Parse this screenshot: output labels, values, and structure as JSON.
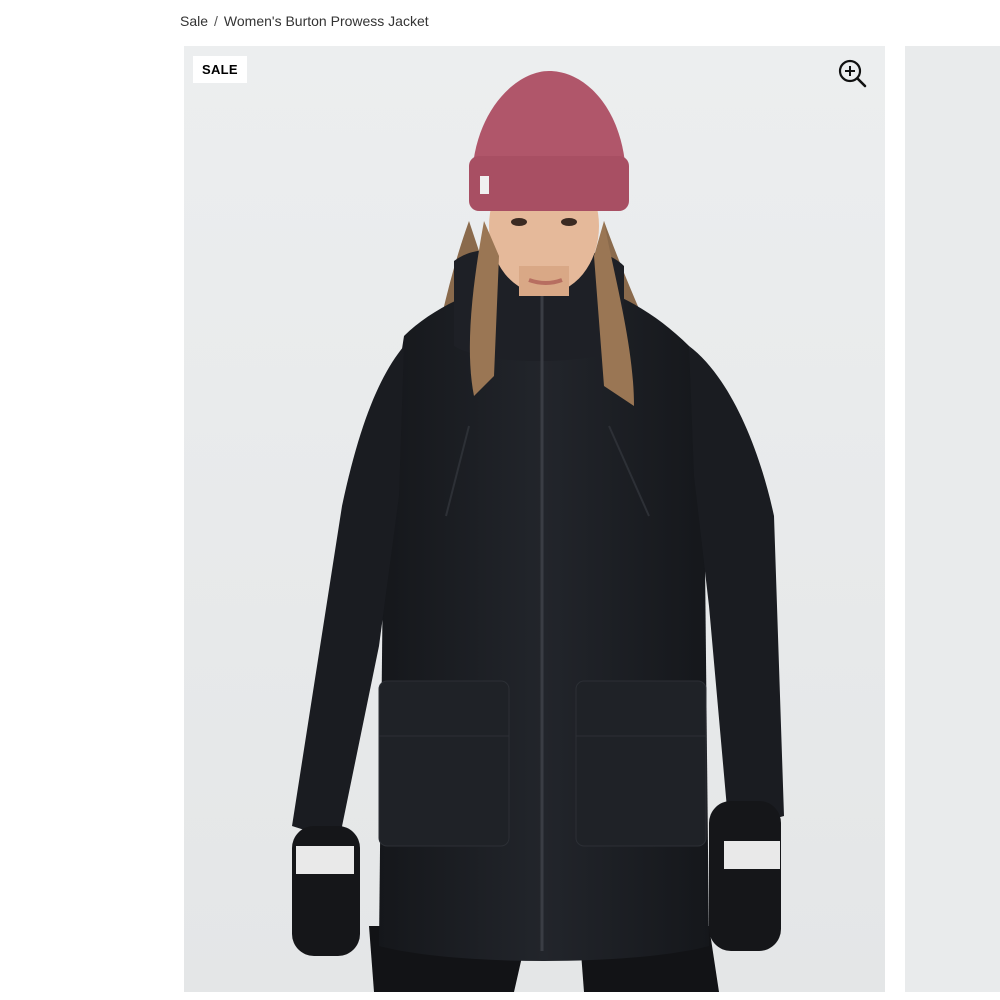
{
  "breadcrumb": {
    "items": [
      "Sale",
      "Women's Burton Prowess Jacket"
    ],
    "separator": "/"
  },
  "gallery": {
    "badge": "SALE",
    "zoom_icon": "zoom-in-icon",
    "colors": {
      "background": "#e9ebec",
      "jacket": "#1b1d22",
      "beanie": "#b0566a"
    }
  }
}
